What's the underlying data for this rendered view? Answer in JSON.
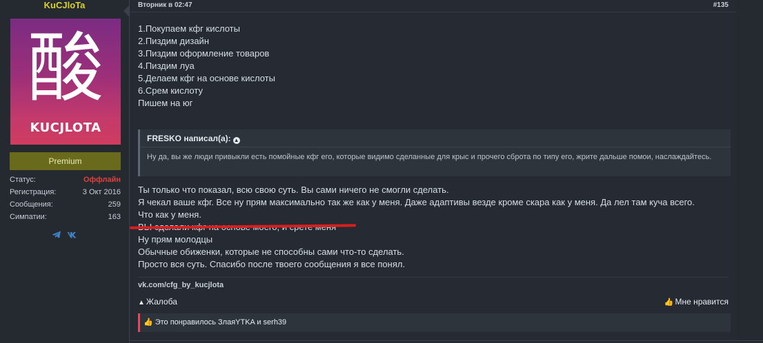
{
  "user": {
    "name": "KuCJloTa",
    "avatar_glyph": "酸",
    "avatar_name": "KUCJLOTA",
    "banner": "Premium",
    "stats": [
      {
        "label": "Статус:",
        "value": "Оффлайн",
        "color": "#e0413a"
      },
      {
        "label": "Регистрация:",
        "value": "3 Окт 2016"
      },
      {
        "label": "Сообщения:",
        "value": "259"
      },
      {
        "label": "Симпатии:",
        "value": "163"
      }
    ],
    "socials": [
      "telegram-icon",
      "vk-icon"
    ]
  },
  "post": {
    "date": "Вторник в 02:47",
    "number": "#135",
    "lines": [
      "1.Покупаем кфг кислоты",
      "2.Пиздим дизайн",
      "3.Пиздим оформление товаров",
      "4.Пиздим луа",
      "5.Делаем кфг на основе кислоты",
      "6.Срем кислоту",
      "",
      "Пишем на юг"
    ],
    "quote": {
      "author": "FRESKO написал(а):",
      "text": "Ну да, вы же люди привыкли есть помойные кфг его, которые видимо сделанные для крыс и прочего сброта по типу его, жрите дальше помои, наслаждайтесь."
    },
    "reply_lines": [
      "Ты только что показал, всю свою суть. Вы сами ничего не смогли сделать.",
      "Я чекал ваше кфг. Все ну прям максимально так же как у меня. Даже адаптивы везде кроме скара как у меня. Да лел там куча всего.",
      "Что как у меня.",
      "ВЫ сделали кфг на основе моего, и срете меня",
      "Ну прям молодцы",
      "Обычные обиженки, которые не способны сами что-то сделать.",
      "Просто вся суть. Спасибо после твоего сообщения я все понял."
    ],
    "signature": "vk.com/cfg_by_kucjlota",
    "report_label": "Жалоба",
    "like_label": "Мне нравится",
    "likes_text": "Это понравилось ЗлаяYTKA и serh39"
  },
  "colors": {
    "username": "#d9d32b",
    "offline": "#e0413a",
    "premium_bg": "#6a6a1d",
    "underline": "#d81e1e",
    "like_accent": "#e04a5a"
  }
}
